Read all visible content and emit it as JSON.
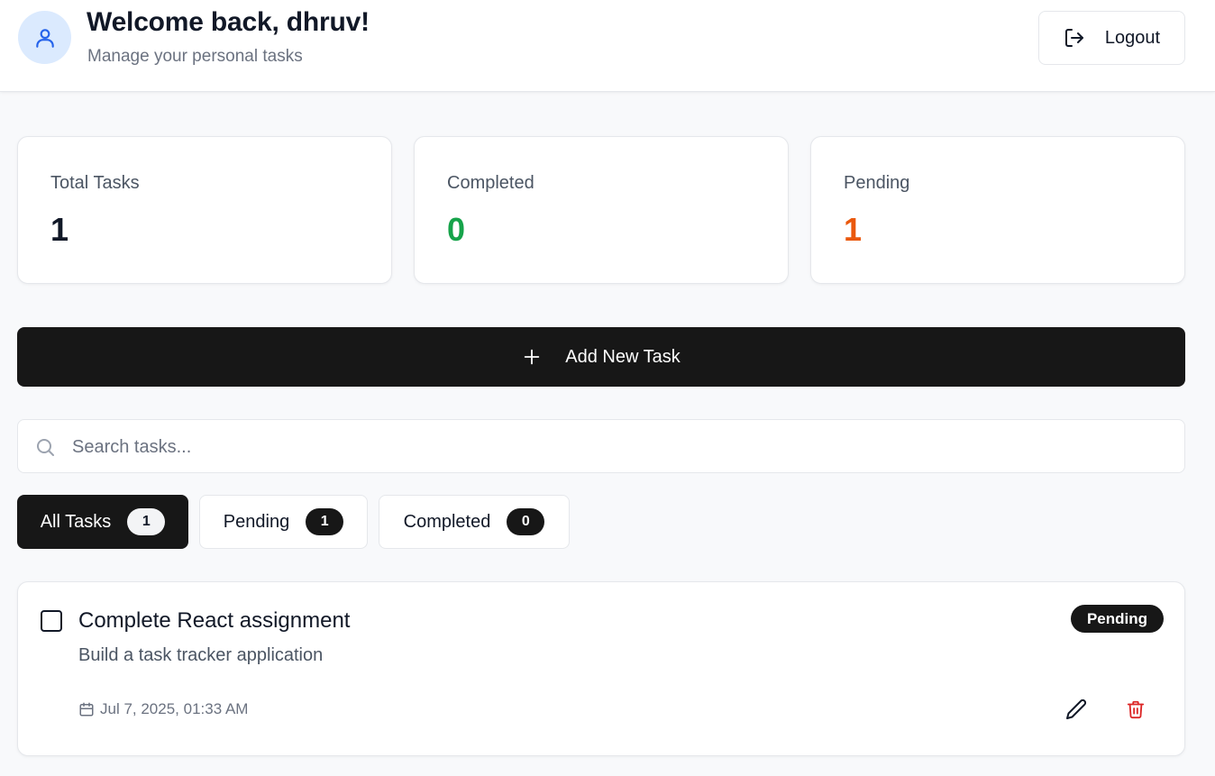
{
  "header": {
    "welcome": "Welcome back, dhruv!",
    "subtitle": "Manage your personal tasks",
    "logout_label": "Logout",
    "avatar_icon": "user-icon",
    "logout_icon": "logout-icon"
  },
  "stats": [
    {
      "label": "Total Tasks",
      "value": "1",
      "color": "#111827"
    },
    {
      "label": "Completed",
      "value": "0",
      "color": "#16a34a"
    },
    {
      "label": "Pending",
      "value": "1",
      "color": "#ea580c"
    }
  ],
  "add_task": {
    "label": "Add New Task",
    "icon": "plus-icon"
  },
  "search": {
    "placeholder": "Search tasks...",
    "value": "",
    "icon": "search-icon"
  },
  "tabs": [
    {
      "label": "All Tasks",
      "count": "1",
      "active": true
    },
    {
      "label": "Pending",
      "count": "1",
      "active": false
    },
    {
      "label": "Completed",
      "count": "0",
      "active": false
    }
  ],
  "tasks": [
    {
      "title": "Complete React assignment",
      "description": "Build a task tracker application",
      "status": "Pending",
      "date": "Jul 7, 2025, 01:33 AM",
      "completed": false
    }
  ],
  "colors": {
    "accent_dark": "#171717",
    "avatar_bg": "#dbeafe",
    "avatar_icon": "#2563eb",
    "delete_red": "#dc2626"
  }
}
